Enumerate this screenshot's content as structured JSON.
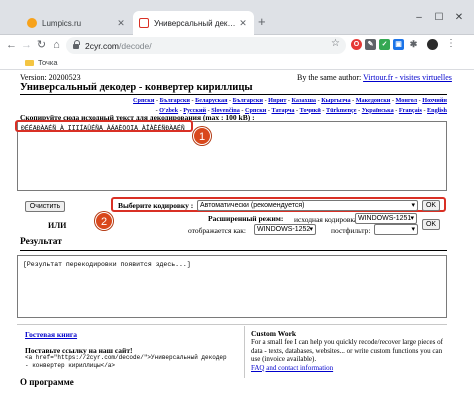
{
  "browser": {
    "tabs": [
      {
        "title": "Lumpics.ru",
        "active": false
      },
      {
        "title": "Универсальный декодер - конв",
        "active": true
      }
    ],
    "new_tab": "+",
    "window_controls": {
      "minimize": "–",
      "maximize": "☐",
      "close": "✕"
    },
    "nav": {
      "back": "←",
      "forward": "→",
      "reload": "↻",
      "home": "⌂"
    },
    "url": {
      "host": "2cyr.com",
      "path": "/decode/"
    },
    "bookmarks": [
      {
        "label": "Точка"
      }
    ]
  },
  "page": {
    "version": "Version: 20200523",
    "by_author_label": "By the same author:",
    "by_author_link": "Virtour.fr - visites virtuelles",
    "title": "Универсальный декодер - конвертер кириллицы",
    "languages": [
      "Српски",
      "Български",
      "Беларуская",
      "Български",
      "Иврит",
      "Казахша",
      "Кыргызча",
      "Македонски",
      "Монгол",
      "Нохчийн",
      "O'zbek",
      "Русский",
      "Slovenčina",
      "Српски",
      "Татарча",
      "Тоҷикӣ",
      "Тürkmençe",
      "Українська",
      "Français",
      "English"
    ],
    "copy_label": "Скопируйте сюда исходный текст для декодирования (max : 100 kB) :",
    "source_text": "ÐÉÉÄÐÀÄÉÑ À ÏÏÏÍÄÛÉÑÄ ÀÁÄÈÖÖÏÄ ÀÎÀÈÉÑÐÀÄÉÑ",
    "clear_button": "Очистить",
    "encoding_label": "Выберите кодировку :",
    "encoding_value": "Автоматически (рекомендуется)",
    "ok_button": "OK",
    "or_label": "ИЛИ",
    "advanced_label": "Расширенный режим:",
    "source_encoding_label": "исходная кодировка:",
    "source_encoding_value": "WINDOWS-1251",
    "displayed_as_label": "отображается как:",
    "displayed_as_value": "WINDOWS-1252",
    "postfilter_label": "постфильтр:",
    "postfilter_value": "",
    "ok_button_2": "OK",
    "result_title": "Результат",
    "result_placeholder": "[Результат перекодировки появится здесь...]",
    "guestbook_link": "Гостевая книга",
    "put_link_title": "Поставьте ссылку на наш сайт!",
    "link_code_1": "<a href=\"https://2cyr.com/decode/\">Универсальный декодер",
    "link_code_2": "- конвертер кириллицы</a>",
    "custom_work_title": "Custom Work",
    "custom_work_text": "For a small fee I can help you quickly recode/recover large pieces of data - texts, databases, websites... or write custom functions you can use (invoice available).",
    "faq_link": "FAQ and contact information",
    "about_title": "О программе"
  },
  "annotations": {
    "marker_1": "1",
    "marker_2": "2"
  },
  "colors": {
    "highlight": "#d93025",
    "link": "#0000cc",
    "badge": "#d9481c"
  }
}
